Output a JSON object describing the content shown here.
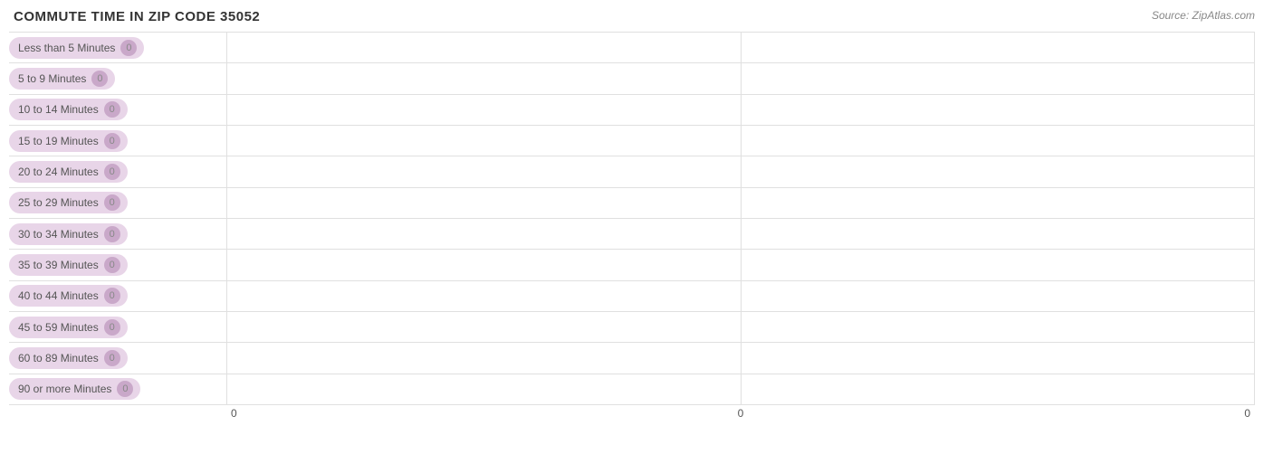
{
  "title": "COMMUTE TIME IN ZIP CODE 35052",
  "source": "Source: ZipAtlas.com",
  "bars": [
    {
      "label": "Less than 5 Minutes",
      "value": 0,
      "display": "0"
    },
    {
      "label": "5 to 9 Minutes",
      "value": 0,
      "display": "0"
    },
    {
      "label": "10 to 14 Minutes",
      "value": 0,
      "display": "0"
    },
    {
      "label": "15 to 19 Minutes",
      "value": 0,
      "display": "0"
    },
    {
      "label": "20 to 24 Minutes",
      "value": 0,
      "display": "0"
    },
    {
      "label": "25 to 29 Minutes",
      "value": 0,
      "display": "0"
    },
    {
      "label": "30 to 34 Minutes",
      "value": 0,
      "display": "0"
    },
    {
      "label": "35 to 39 Minutes",
      "value": 0,
      "display": "0"
    },
    {
      "label": "40 to 44 Minutes",
      "value": 0,
      "display": "0"
    },
    {
      "label": "45 to 59 Minutes",
      "value": 0,
      "display": "0"
    },
    {
      "label": "60 to 89 Minutes",
      "value": 0,
      "display": "0"
    },
    {
      "label": "90 or more Minutes",
      "value": 0,
      "display": "0"
    }
  ],
  "axis": {
    "labels": [
      "0",
      "0",
      "0"
    ]
  },
  "colors": {
    "pill_bg": "#e8d5e8",
    "pill_value_bg": "#c9a8c9",
    "bar_fill": "#c9a8c9",
    "grid": "#e0e0e0"
  }
}
